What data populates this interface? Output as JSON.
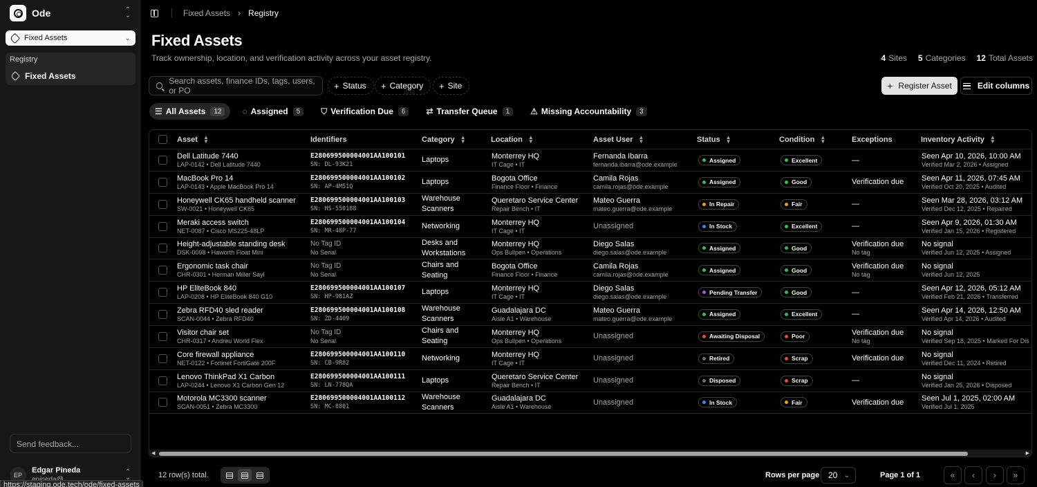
{
  "sidebar": {
    "workspace": "Ode",
    "module": "Fixed Assets",
    "group_label": "Registry",
    "nav_item": "Fixed Assets",
    "feedback_placeholder": "Send feedback...",
    "user": {
      "initials": "EP",
      "name": "Edgar Pineda",
      "email": "epineda@..."
    },
    "status_url": "https://staging.ode.tech/ode/fixed-assets"
  },
  "breadcrumb": {
    "parent": "Fixed Assets",
    "current": "Registry"
  },
  "header": {
    "title": "Fixed Assets",
    "subtitle": "Track ownership, location, and verification activity across your asset registry.",
    "stats": [
      {
        "value": "4",
        "label": "Sites"
      },
      {
        "value": "5",
        "label": "Categories"
      },
      {
        "value": "12",
        "label": "Total Assets"
      }
    ]
  },
  "toolbar": {
    "search_placeholder": "Search assets, finance IDs, tags, users, or PO",
    "filters": [
      "Status",
      "Category",
      "Site"
    ],
    "register_label": "Register Asset",
    "edit_columns_label": "Edit columns"
  },
  "tabs": [
    {
      "label": "All Assets",
      "count": "12",
      "icon": "list-icon"
    },
    {
      "label": "Assigned",
      "count": "5",
      "icon": "check-circle-icon"
    },
    {
      "label": "Verification Due",
      "count": "6",
      "icon": "shield-icon"
    },
    {
      "label": "Transfer Queue",
      "count": "1",
      "icon": "transfer-icon"
    },
    {
      "label": "Missing Accountability",
      "count": "3",
      "icon": "warning-icon"
    }
  ],
  "columns": [
    "Asset",
    "Identifiers",
    "Category",
    "Location",
    "Asset User",
    "Status",
    "Condition",
    "Exceptions",
    "Inventory Activity"
  ],
  "status_colors": {
    "Assigned": "#22c55e",
    "In Repair": "#f59e0b",
    "In Stock": "#3b82f6",
    "Pending Transfer": "#a855f7",
    "Awaiting Disposal": "#ef4444",
    "Retired": "#71717a",
    "Disposed": "#71717a"
  },
  "condition_colors": {
    "Excellent": "#22c55e",
    "Good": "#22c55e",
    "Fair": "#f59e0b",
    "Poor": "#ef4444",
    "Scrap": "#ef4444"
  },
  "rows": [
    {
      "name": "Dell Latitude 7440",
      "sub": "LAP-0142 • Dell Latitude 7440",
      "id": "E280699500004001AA100101",
      "sn": "SN: DL-93K21",
      "category": "Laptops",
      "loc": "Monterrey HQ",
      "loc_sub": "IT Cage • IT",
      "user": "Fernanda Ibarra",
      "user_email": "fernanda.ibarra@ode.example",
      "status": "Assigned",
      "condition": "Excellent",
      "exception": "—",
      "exception_sub": "",
      "activity": "Seen Apr 10, 2026, 10:00 AM",
      "activity_sub": "Verified Mar 2, 2026 • Assigned"
    },
    {
      "name": "MacBook Pro 14",
      "sub": "LAP-0143 • Apple MacBook Pro 14",
      "id": "E280699500004001AA100102",
      "sn": "SN: AP-4M51Q",
      "category": "Laptops",
      "loc": "Bogota Office",
      "loc_sub": "Finance Floor • Finance",
      "user": "Camila Rojas",
      "user_email": "camila.rojas@ode.example",
      "status": "Assigned",
      "condition": "Good",
      "exception": "Verification due",
      "exception_sub": "",
      "activity": "Seen Apr 11, 2026, 07:45 AM",
      "activity_sub": "Verified Oct 20, 2025 • Audited"
    },
    {
      "name": "Honeywell CK65 handheld scanner",
      "sub": "SW-0021 • Honeywell CK65",
      "id": "E280699500004001AA100103",
      "sn": "SN: HS-550188",
      "category": "Warehouse Scanners",
      "loc": "Queretaro Service Center",
      "loc_sub": "Repair Bench • IT",
      "user": "Mateo Guerra",
      "user_email": "mateo.guerra@ode.example",
      "status": "In Repair",
      "condition": "Fair",
      "exception": "—",
      "exception_sub": "",
      "activity": "Seen Mar 28, 2026, 03:12 AM",
      "activity_sub": "Verified Dec 12, 2025 • Repaired"
    },
    {
      "name": "Meraki access switch",
      "sub": "NET-0087 • Cisco MS225-48LP",
      "id": "E280699500004001AA100104",
      "sn": "SN: MR-48P-77",
      "category": "Networking",
      "loc": "Monterrey HQ",
      "loc_sub": "IT Cage • IT",
      "user": "Unassigned",
      "user_email": "",
      "status": "In Stock",
      "condition": "Excellent",
      "exception": "—",
      "exception_sub": "",
      "activity": "Seen Apr 9, 2026, 01:30 AM",
      "activity_sub": "Verified Jan 15, 2026 • Registered"
    },
    {
      "name": "Height-adjustable standing desk",
      "sub": "DSK-0098 • Haworth Float Mini",
      "id": "No Tag ID",
      "sn": "No Serial",
      "category": "Desks and Workstations",
      "loc": "Monterrey HQ",
      "loc_sub": "Ops Bullpen • Operations",
      "user": "Diego Salas",
      "user_email": "diego.salas@ode.example",
      "status": "Assigned",
      "condition": "Good",
      "exception": "Verification due",
      "exception_sub": "No tag",
      "activity": "No signal",
      "activity_sub": "Verified Jun 12, 2025 • Assigned"
    },
    {
      "name": "Ergonomic task chair",
      "sub": "CHR-0301 • Herman Miller Sayl",
      "id": "No Tag ID",
      "sn": "No Serial",
      "category": "Chairs and Seating",
      "loc": "Bogota Office",
      "loc_sub": "Finance Floor • Finance",
      "user": "Camila Rojas",
      "user_email": "camila.rojas@ode.example",
      "status": "Assigned",
      "condition": "Good",
      "exception": "Verification due",
      "exception_sub": "No tag",
      "activity": "No signal",
      "activity_sub": "Verified Jun 12, 2025"
    },
    {
      "name": "HP EliteBook 840",
      "sub": "LAP-0208 • HP EliteBook 840 G10",
      "id": "E280699500004001AA100107",
      "sn": "SN: HP-981AZ",
      "category": "Laptops",
      "loc": "Monterrey HQ",
      "loc_sub": "IT Cage • IT",
      "user": "Diego Salas",
      "user_email": "diego.salas@ode.example",
      "status": "Pending Transfer",
      "condition": "Good",
      "exception": "—",
      "exception_sub": "",
      "activity": "Seen Apr 12, 2026, 05:12 AM",
      "activity_sub": "Verified Feb 21, 2026 • Transferred"
    },
    {
      "name": "Zebra RFD40 sled reader",
      "sub": "SCAN-0044 • Zebra RFD40",
      "id": "E280699500004001AA100108",
      "sn": "SN: ZD-4409",
      "category": "Warehouse Scanners",
      "loc": "Guadalajara DC",
      "loc_sub": "Aisle A1 • Warehouse",
      "user": "Mateo Guerra",
      "user_email": "mateo.guerra@ode.example",
      "status": "Assigned",
      "condition": "Excellent",
      "exception": "—",
      "exception_sub": "",
      "activity": "Seen Apr 14, 2026, 12:50 AM",
      "activity_sub": "Verified Apr 14, 2026 • Audited"
    },
    {
      "name": "Visitor chair set",
      "sub": "CHR-0317 • Andreu World Flex",
      "id": "No Tag ID",
      "sn": "No Serial",
      "category": "Chairs and Seating",
      "loc": "Monterrey HQ",
      "loc_sub": "Ops Bullpen • Operations",
      "user": "Unassigned",
      "user_email": "",
      "status": "Awaiting Disposal",
      "condition": "Poor",
      "exception": "Verification due",
      "exception_sub": "No tag",
      "activity": "No signal",
      "activity_sub": "Verified Sep 18, 2025 • Marked For Dis"
    },
    {
      "name": "Core firewall appliance",
      "sub": "NET-0122 • Fortinet FortiGate 200F",
      "id": "E280699500004001AA100110",
      "sn": "SN: CB-9R82",
      "category": "Networking",
      "loc": "Monterrey HQ",
      "loc_sub": "IT Cage • IT",
      "user": "Unassigned",
      "user_email": "",
      "status": "Retired",
      "condition": "Scrap",
      "exception": "Verification due",
      "exception_sub": "",
      "activity": "No signal",
      "activity_sub": "Verified Dec 11, 2024 • Retired"
    },
    {
      "name": "Lenovo ThinkPad X1 Carbon",
      "sub": "LAP-0244 • Lenovo X1 Carbon Gen 12",
      "id": "E280699500004001AA100111",
      "sn": "SN: LN-778QA",
      "category": "Laptops",
      "loc": "Queretaro Service Center",
      "loc_sub": "Repair Bench • IT",
      "user": "Unassigned",
      "user_email": "",
      "status": "Disposed",
      "condition": "Scrap",
      "exception": "—",
      "exception_sub": "",
      "activity": "No signal",
      "activity_sub": "Verified Jan 25, 2026 • Disposed"
    },
    {
      "name": "Motorola MC3300 scanner",
      "sub": "SCAN-0051 • Zebra MC3300",
      "id": "E280699500004001AA100112",
      "sn": "SN: MC-8801",
      "category": "Warehouse Scanners",
      "loc": "Guadalajara DC",
      "loc_sub": "Aisle A1 • Warehouse",
      "user": "Unassigned",
      "user_email": "",
      "status": "In Stock",
      "condition": "Fair",
      "exception": "Verification due",
      "exception_sub": "",
      "activity": "Seen Jul 1, 2025, 02:00 AM",
      "activity_sub": "Verified Jul 1, 2025"
    }
  ],
  "footer": {
    "row_count": "12 row(s) total.",
    "rows_per_page_label": "Rows per page",
    "rows_per_page": "20",
    "page_label": "Page 1 of 1"
  }
}
